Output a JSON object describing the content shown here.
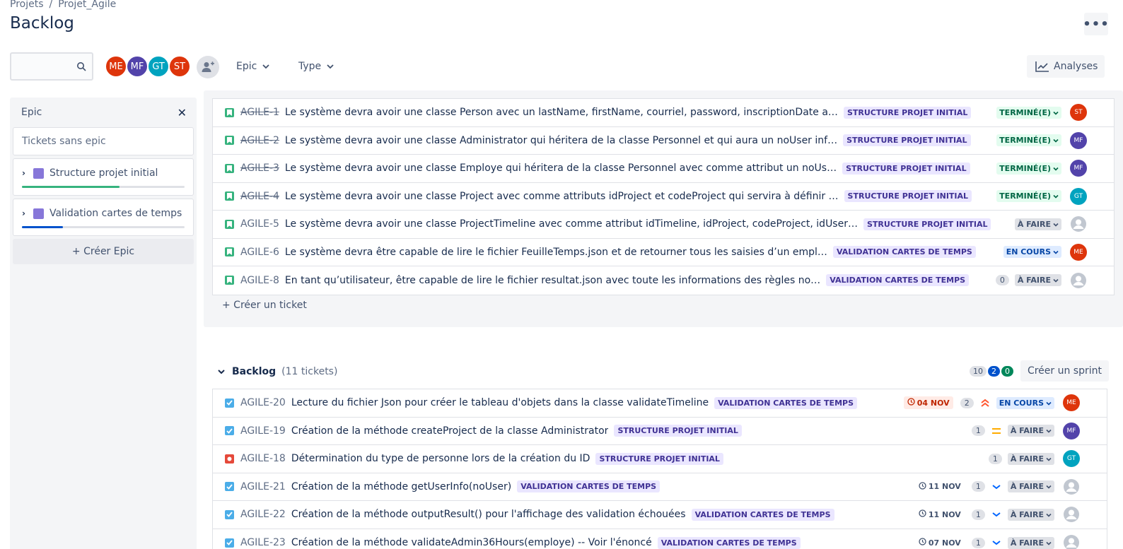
{
  "breadcrumb": {
    "projects": "Projets",
    "separator": "/",
    "project": "Projet_Agile"
  },
  "page_title": "Backlog",
  "more_label": "•••",
  "toolbar": {
    "search_value": "",
    "avatars": [
      {
        "initials": "ME",
        "color": "#de350b"
      },
      {
        "initials": "MF",
        "color": "#5243aa"
      },
      {
        "initials": "GT",
        "color": "#00a3bf"
      },
      {
        "initials": "ST",
        "color": "#de350b"
      }
    ],
    "filter_epic": "Epic",
    "filter_type": "Type",
    "analyses": "Analyses"
  },
  "epic_panel": {
    "title": "Epic",
    "no_epic": "Tickets sans epic",
    "epics": [
      {
        "name": "Structure projet initial",
        "progress": 0.6,
        "color": "#36b37e"
      },
      {
        "name": "Validation cartes de temps",
        "progress": 0.25,
        "color": "#0052cc"
      }
    ],
    "create": "+ Créer Epic"
  },
  "sprint": {
    "issues": [
      {
        "key": "AGILE-1",
        "done": true,
        "type": "story",
        "summary": "Le système devra avoir une classe Person avec un lastName, firstName, courriel, password, inscriptionDate a…",
        "epic": "STRUCTURE PROJET INITIAL",
        "status": "TERMINÉ(E)",
        "status_kind": "done",
        "assignee": "ST",
        "assignee_color": "#de350b"
      },
      {
        "key": "AGILE-2",
        "done": true,
        "type": "story",
        "summary": "Le système devra avoir une classe Administrator qui héritera de la classe Personnel et qui aura un noUser inf…",
        "epic": "STRUCTURE PROJET INITIAL",
        "status": "TERMINÉ(E)",
        "status_kind": "done",
        "assignee": "MF",
        "assignee_color": "#5243aa"
      },
      {
        "key": "AGILE-3",
        "done": true,
        "type": "story",
        "summary": "Le système devra avoir une classe Employe qui héritera de la classe Personnel avec comme attribut un noUs…",
        "epic": "STRUCTURE PROJET INITIAL",
        "status": "TERMINÉ(E)",
        "status_kind": "done",
        "assignee": "MF",
        "assignee_color": "#5243aa"
      },
      {
        "key": "AGILE-4",
        "done": true,
        "type": "story",
        "summary": "Le système devra avoir une classe Project avec comme attributs idProject et codeProject qui servira à définir …",
        "epic": "STRUCTURE PROJET INITIAL",
        "status": "TERMINÉ(E)",
        "status_kind": "done",
        "assignee": "GT",
        "assignee_color": "#00a3bf"
      },
      {
        "key": "AGILE-5",
        "done": false,
        "type": "story",
        "summary": "Le système devra avoir une classe ProjectTimeline avec comme attribut idTimeline, idProject, codeProject, idUser…",
        "epic": "STRUCTURE PROJET INITIAL",
        "status": "À FAIRE",
        "status_kind": "todo",
        "assignee": "",
        "assignee_color": ""
      },
      {
        "key": "AGILE-6",
        "done": false,
        "type": "story",
        "summary": "Le système devra être capable de lire le fichier FeuilleTemps.json et de retourner tous les saisies d’un empl…",
        "epic": "VALIDATION CARTES DE TEMPS",
        "status": "EN COURS",
        "status_kind": "prog",
        "assignee": "ME",
        "assignee_color": "#de350b"
      },
      {
        "key": "AGILE-8",
        "done": false,
        "type": "story",
        "summary": "En tant qu’utilisateur, être capable de lire le fichier resultat.json avec toute les informations des règles no…",
        "epic": "VALIDATION CARTES DE TEMPS",
        "estimate": "0",
        "status": "À FAIRE",
        "status_kind": "todo",
        "assignee": "",
        "assignee_color": ""
      }
    ],
    "create_ticket": "+ Créer un ticket"
  },
  "backlog": {
    "title": "Backlog",
    "count": "(11 tickets)",
    "pills": [
      {
        "value": "10",
        "bg": "#dfe1e6",
        "fg": "#42526e"
      },
      {
        "value": "2",
        "bg": "#0052cc",
        "fg": "#ffffff"
      },
      {
        "value": "0",
        "bg": "#00875a",
        "fg": "#ffffff"
      }
    ],
    "create_sprint": "Créer un sprint",
    "issues": [
      {
        "key": "AGILE-20",
        "type": "task",
        "summary": "Lecture du fichier Json pour créer le tableau d'objets dans la classe validateTimeline",
        "epic": "VALIDATION CARTES DE TEMPS",
        "date": "04 NOV",
        "date_overdue": true,
        "estimate": "2",
        "priority": "highest",
        "status": "EN COURS",
        "status_kind": "prog",
        "assignee": "ME",
        "assignee_color": "#de350b"
      },
      {
        "key": "AGILE-19",
        "type": "task",
        "summary": "Création de la méthode createProject de la classe Administrator",
        "epic": "STRUCTURE PROJET INITIAL",
        "date": "",
        "estimate": "1",
        "priority": "medium",
        "status": "À FAIRE",
        "status_kind": "todo",
        "assignee": "MF",
        "assignee_color": "#5243aa"
      },
      {
        "key": "AGILE-18",
        "type": "bug",
        "summary": "Détermination du type de personne lors de la création du ID",
        "epic": "STRUCTURE PROJET INITIAL",
        "date": "",
        "estimate": "1",
        "priority": "",
        "status": "À FAIRE",
        "status_kind": "todo",
        "assignee": "GT",
        "assignee_color": "#00a3bf"
      },
      {
        "key": "AGILE-21",
        "type": "task",
        "summary": "Création de la méthode getUserInfo(noUser)",
        "epic": "VALIDATION CARTES DE TEMPS",
        "date": "11 NOV",
        "date_overdue": false,
        "estimate": "1",
        "priority": "low",
        "status": "À FAIRE",
        "status_kind": "todo",
        "assignee": "",
        "assignee_color": ""
      },
      {
        "key": "AGILE-22",
        "type": "task",
        "summary": "Création de la méthode outputResult() pour l'affichage des validation échouées",
        "epic": "VALIDATION CARTES DE TEMPS",
        "date": "11 NOV",
        "date_overdue": false,
        "estimate": "1",
        "priority": "low",
        "status": "À FAIRE",
        "status_kind": "todo",
        "assignee": "",
        "assignee_color": ""
      },
      {
        "key": "AGILE-23",
        "type": "task",
        "summary": "Création de la méthode validateAdmin36Hours(employe) -- Voir l'énoncé",
        "epic": "VALIDATION CARTES DE TEMPS",
        "date": "07 NOV",
        "date_overdue": false,
        "estimate": "1",
        "priority": "low",
        "status": "À FAIRE",
        "status_kind": "todo",
        "assignee": "",
        "assignee_color": ""
      }
    ]
  }
}
